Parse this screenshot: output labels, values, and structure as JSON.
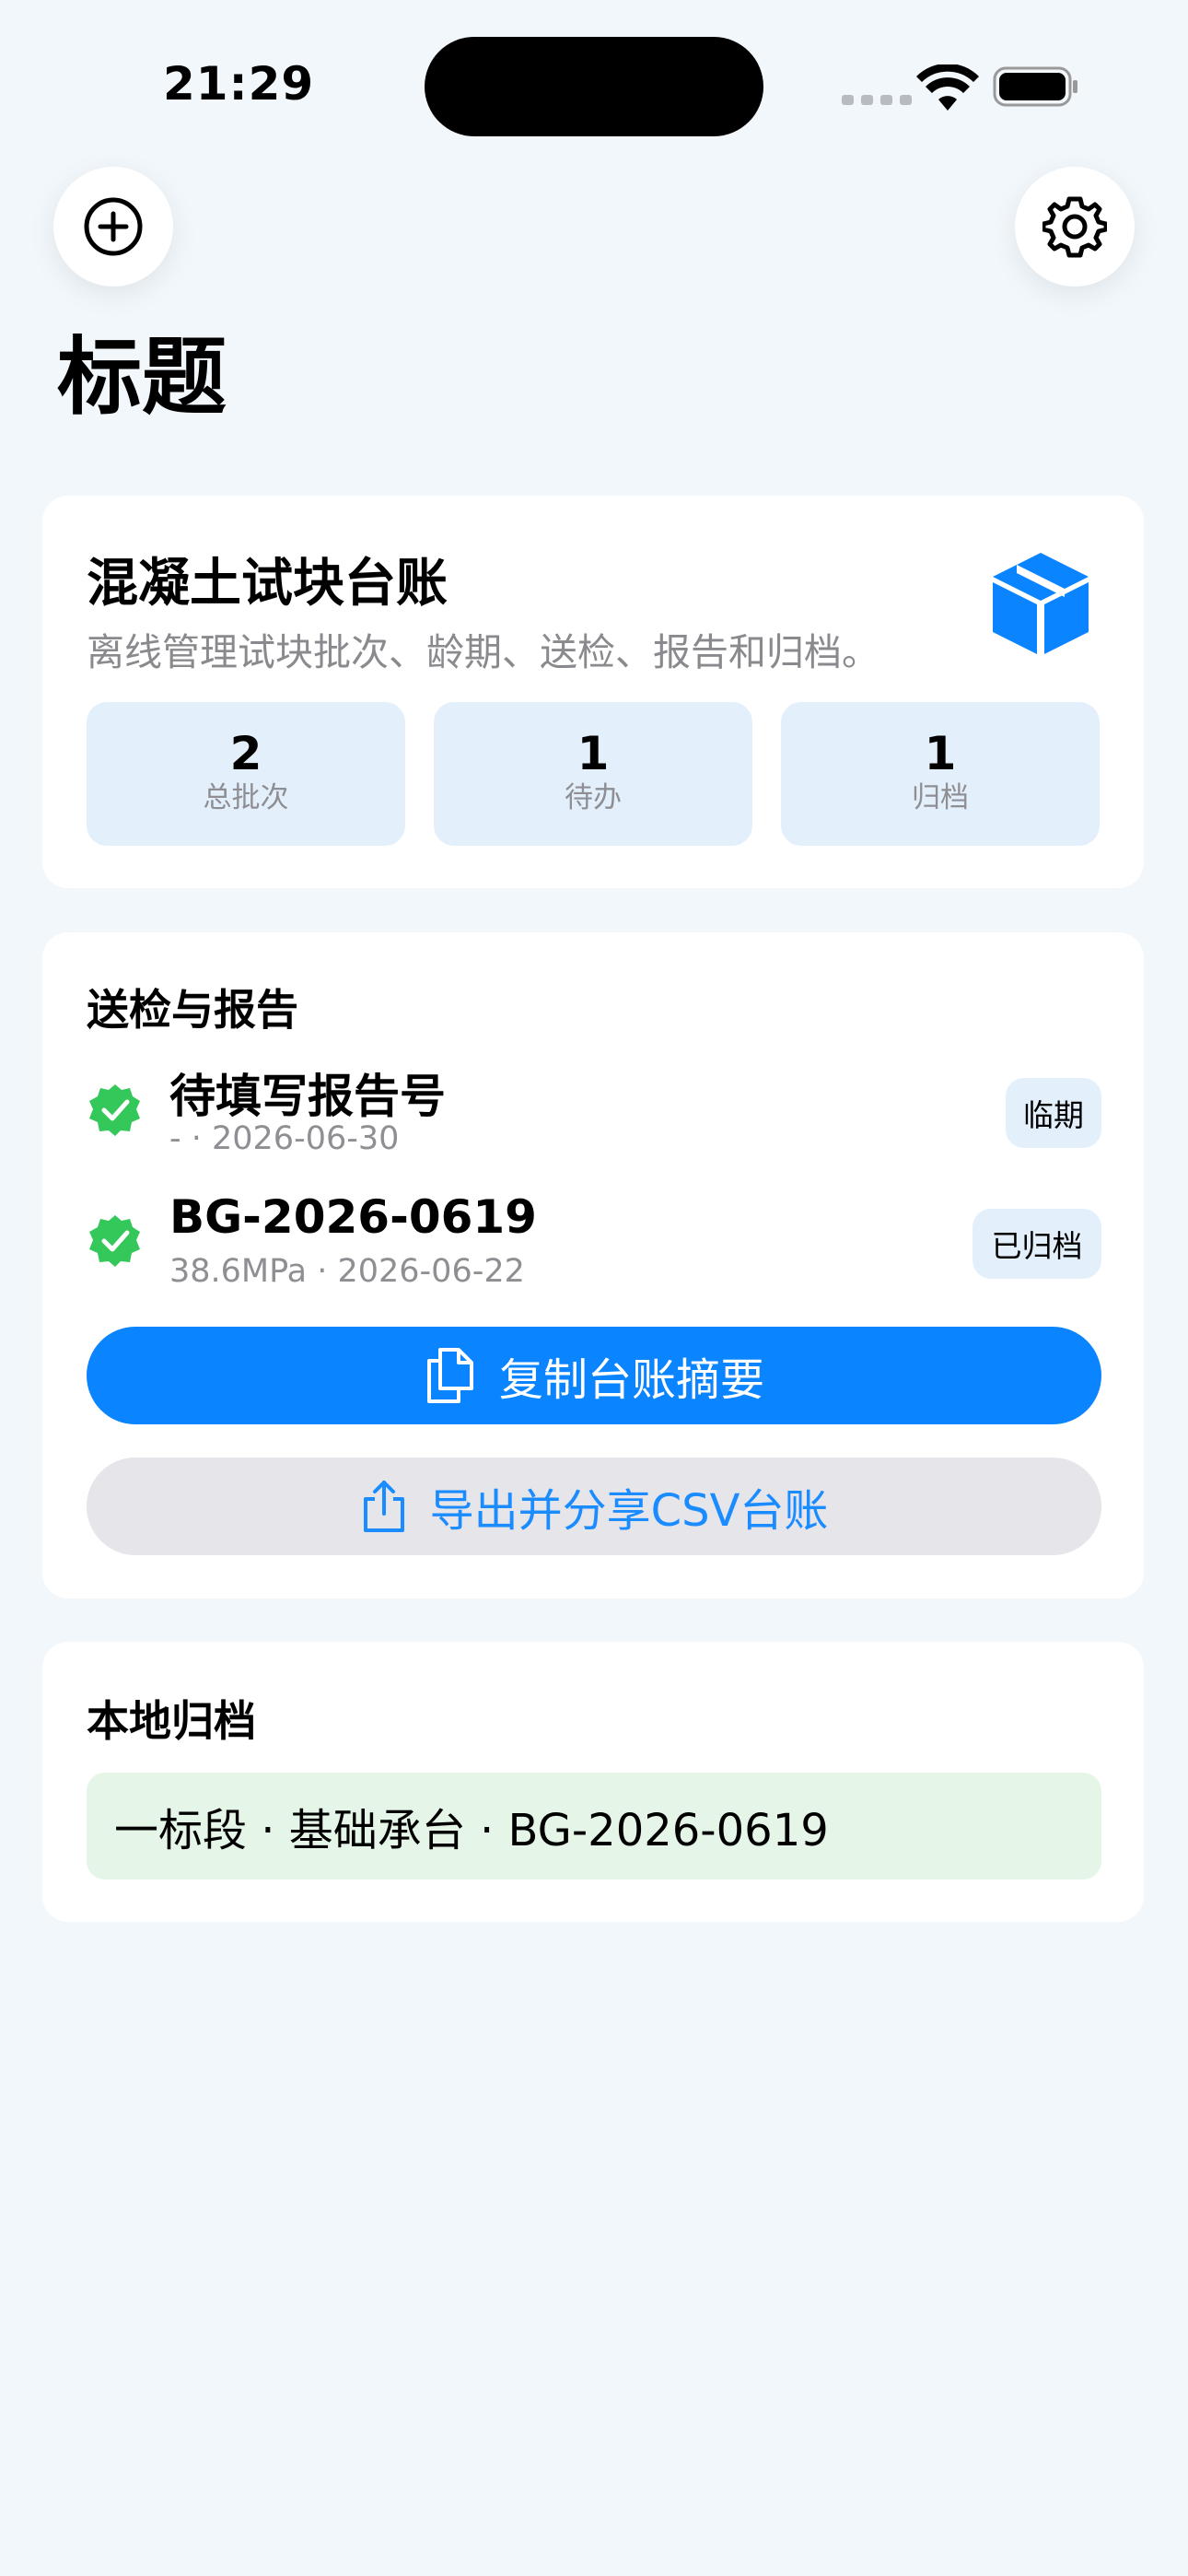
{
  "status_bar": {
    "time": "21:29"
  },
  "nav": {
    "title": "标题",
    "add_icon": "plus-circle-icon",
    "settings_icon": "gear-icon"
  },
  "header_card": {
    "title": "混凝土试块台账",
    "subtitle": "离线管理试块批次、龄期、送检、报告和归档。",
    "icon": "cube-icon",
    "accent": "#0a84ff",
    "stats": [
      {
        "value": "2",
        "label": "总批次"
      },
      {
        "value": "1",
        "label": "待办"
      },
      {
        "value": "1",
        "label": "归档"
      }
    ]
  },
  "reports_card": {
    "title": "送检与报告",
    "rows": [
      {
        "title": "待填写报告号",
        "subtitle": "- · 2026-06-30",
        "badge": "临期",
        "icon": "checkmark-seal-icon"
      },
      {
        "title": "BG-2026-0619",
        "subtitle": "38.6MPa · 2026-06-22",
        "badge": "已归档",
        "icon": "checkmark-seal-icon"
      }
    ],
    "primary_button": "复制台账摘要",
    "secondary_button": "导出并分享CSV台账",
    "success_color": "#34c759"
  },
  "archive_card": {
    "title": "本地归档",
    "items": [
      "一标段 · 基础承台 · BG-2026-0619"
    ]
  }
}
